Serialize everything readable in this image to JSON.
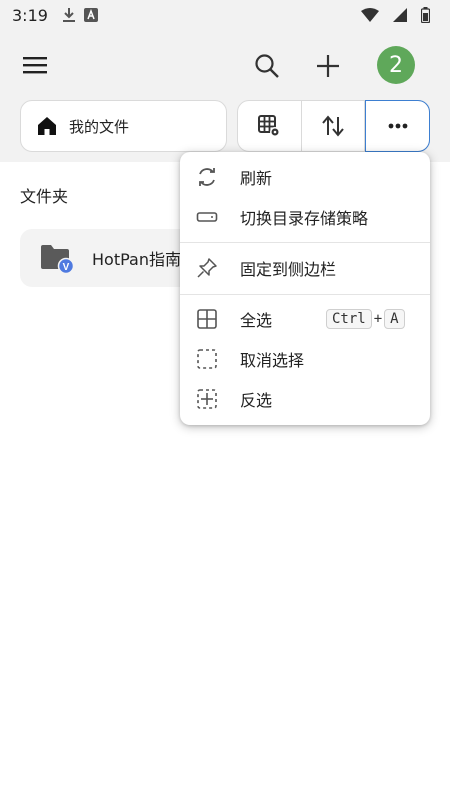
{
  "status_bar": {
    "time": "3:19",
    "icons": [
      "download-icon",
      "text-icon",
      "wifi-icon",
      "signal-icon",
      "battery-icon"
    ]
  },
  "app_bar": {
    "avatar_label": "2",
    "avatar_color": "#5fa85a"
  },
  "toolbar": {
    "path_label": "我的文件"
  },
  "content": {
    "section_title": "文件夹",
    "folders": [
      {
        "name": "HotPan指南",
        "badge": "V",
        "badge_color": "#4f7ae0"
      }
    ]
  },
  "menu": {
    "items": [
      {
        "label": "刷新",
        "icon": "refresh-icon"
      },
      {
        "label": "切换目录存储策略",
        "icon": "storage-icon"
      },
      {
        "label": "固定到侧边栏",
        "icon": "pin-icon"
      },
      {
        "label": "全选",
        "icon": "select-all-icon",
        "shortcut": [
          "Ctrl",
          "+",
          "A"
        ]
      },
      {
        "label": "取消选择",
        "icon": "deselect-icon"
      },
      {
        "label": "反选",
        "icon": "invert-selection-icon"
      }
    ]
  },
  "colors": {
    "accent": "#3d7fd1",
    "avatar": "#5fa85a"
  }
}
